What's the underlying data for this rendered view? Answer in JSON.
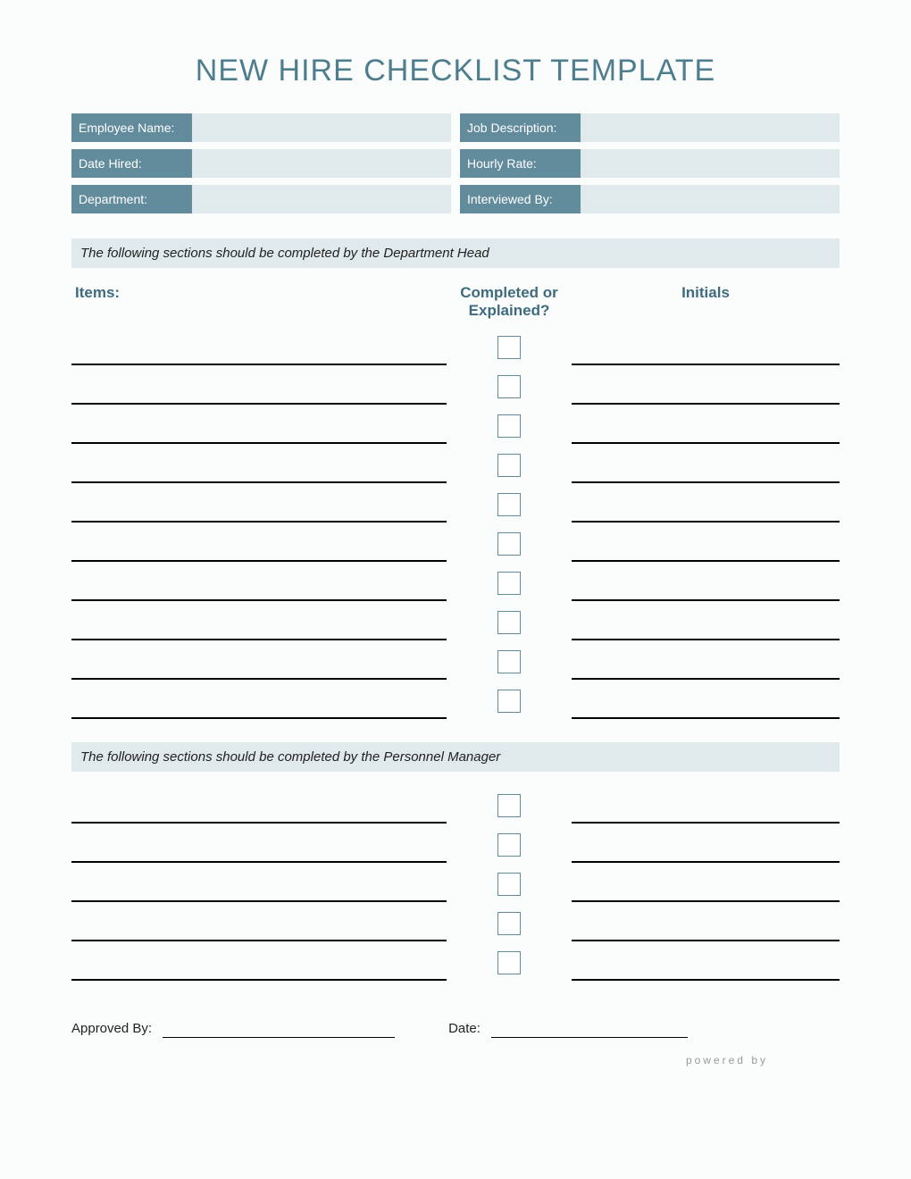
{
  "title": "NEW HIRE CHECKLIST TEMPLATE",
  "info": {
    "employee_name_label": "Employee Name:",
    "job_description_label": "Job Description:",
    "date_hired_label": "Date Hired:",
    "hourly_rate_label": "Hourly Rate:",
    "department_label": "Department:",
    "interviewed_by_label": "Interviewed By:",
    "employee_name": "",
    "job_description": "",
    "date_hired": "",
    "hourly_rate": "",
    "department": "",
    "interviewed_by": ""
  },
  "section1_note": "The following sections should be completed by the Department Head",
  "columns": {
    "items": "Items:",
    "completed": "Completed or Explained?",
    "initials": "Initials"
  },
  "section1_rows": 10,
  "section2_note": "The following sections should be completed by the Personnel Manager",
  "section2_rows": 5,
  "footer": {
    "approved_by_label": "Approved By:",
    "date_label": "Date:",
    "approved_by": "",
    "date": ""
  },
  "powered_by": "powered by"
}
